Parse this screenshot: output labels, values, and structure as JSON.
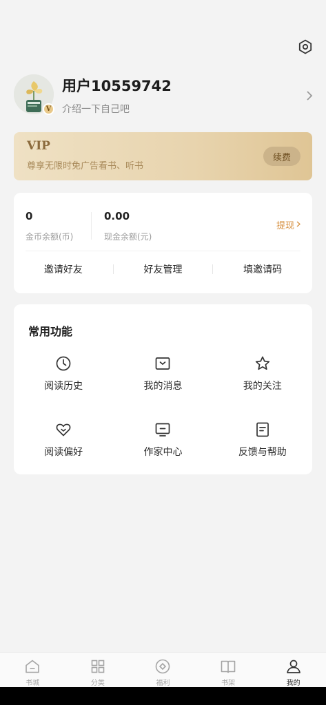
{
  "header": {
    "settings_icon": "settings-icon"
  },
  "profile": {
    "username": "用户10559742",
    "bio": "介绍一下自己吧",
    "vip_badge": "V"
  },
  "vip": {
    "title": "VIP",
    "subtitle": "尊享无限时免广告看书、听书",
    "renew_label": "续费"
  },
  "wallet": {
    "coins_value": "0",
    "coins_label": "金币余额(币)",
    "cash_value": "0.00",
    "cash_label": "现金余额(元)",
    "withdraw_label": "提现",
    "actions": [
      "邀请好友",
      "好友管理",
      "填邀请码"
    ]
  },
  "functions": {
    "title": "常用功能",
    "items": [
      {
        "label": "阅读历史",
        "icon": "clock-icon"
      },
      {
        "label": "我的消息",
        "icon": "message-icon"
      },
      {
        "label": "我的关注",
        "icon": "star-icon"
      },
      {
        "label": "阅读偏好",
        "icon": "heart-icon"
      },
      {
        "label": "作家中心",
        "icon": "monitor-icon"
      },
      {
        "label": "反馈与帮助",
        "icon": "document-icon"
      }
    ]
  },
  "tabbar": {
    "items": [
      {
        "label": "书城",
        "icon": "home-icon"
      },
      {
        "label": "分类",
        "icon": "grid-icon"
      },
      {
        "label": "福利",
        "icon": "diamond-icon"
      },
      {
        "label": "书架",
        "icon": "book-icon"
      },
      {
        "label": "我的",
        "icon": "user-icon"
      }
    ],
    "active": "我的"
  },
  "colors": {
    "accent": "#d79243",
    "vip_text": "#8b6a3c",
    "background": "#f3f3f3"
  }
}
